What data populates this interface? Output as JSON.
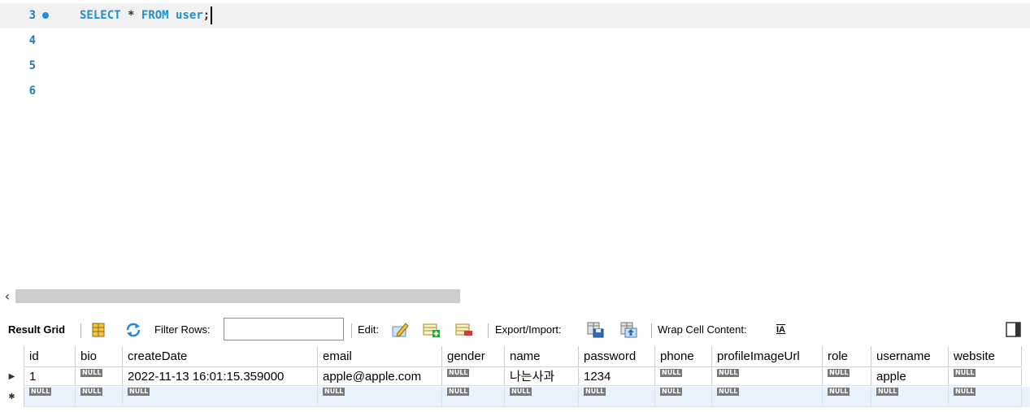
{
  "editor": {
    "lines": [
      {
        "number": "3",
        "sql_keyword1": "SELECT",
        "sql_star": "*",
        "sql_keyword2": "FROM",
        "sql_table": "user",
        "sql_end": ";"
      },
      {
        "number": "4"
      },
      {
        "number": "5"
      },
      {
        "number": "6"
      }
    ]
  },
  "toolbar": {
    "result_grid_label": "Result Grid",
    "filter_rows_label": "Filter Rows:",
    "filter_rows_value": "",
    "edit_label": "Edit:",
    "export_import_label": "Export/Import:",
    "wrap_cell_label": "Wrap Cell Content:",
    "wrap_icon_glyph": "IA"
  },
  "grid": {
    "columns": [
      "id",
      "bio",
      "createDate",
      "email",
      "gender",
      "name",
      "password",
      "phone",
      "profileImageUrl",
      "role",
      "username",
      "website"
    ],
    "null_label": "NULL",
    "row_marker_current": "▶",
    "row_marker_new": "✱",
    "rows": [
      {
        "id": "1",
        "bio": null,
        "createDate": "2022-11-13 16:01:15.359000",
        "email": "apple@apple.com",
        "gender": null,
        "name": "나는사과",
        "password": "1234",
        "phone": null,
        "profileImageUrl": null,
        "role": null,
        "username": "apple",
        "website": null
      }
    ]
  },
  "colors": {
    "line_number": "#2a7ab0",
    "sql_keyword": "#1f8fd0",
    "null_badge": "#7a7a7a",
    "new_row_bg": "#e9f3fd",
    "current_line_bg": "#f1f1f1"
  },
  "icons": [
    "execution-dot-icon",
    "scroll-left-icon",
    "form-editor-icon",
    "refresh-icon",
    "edit-cell-icon",
    "add-row-icon",
    "delete-row-icon",
    "export-icon",
    "import-icon",
    "wrap-cell-icon",
    "toggle-panel-icon"
  ]
}
